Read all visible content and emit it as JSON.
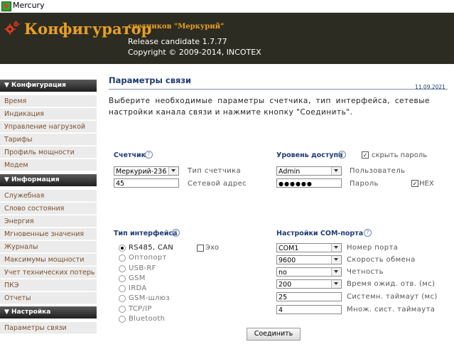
{
  "window": {
    "title": "Mercury"
  },
  "header": {
    "brand": "Конфигуратор",
    "subtitle": "счетчиков \"Меркурий\"",
    "release": "Release candidate 1.7.77",
    "copyright": "Copyright © 2009-2014, INCOTEX"
  },
  "sidebar": {
    "sections": [
      {
        "title": "▼ Конфигурация",
        "items": [
          "Время",
          "Индикация",
          "Управление нагрузкой",
          "Тарифы",
          "Профиль мощности",
          "Модем"
        ]
      },
      {
        "title": "▼ Информация",
        "items": [
          "Служебная",
          "Слово состояния",
          "Энергия",
          "Мгновенные значения",
          "Журналы",
          "Максимумы мощности",
          "Учет технических потерь",
          "ПКЭ",
          "Отчеты"
        ]
      },
      {
        "title": "▼ Настройка",
        "items": [
          "Параметры связи"
        ]
      }
    ]
  },
  "main": {
    "title": "Параметры связи",
    "date": "11.09.2021",
    "intro": "Выберите необходимые параметры счетчика, тип интерфейса, сетевые настройки канала связи и нажмите кнопку \"Соединить\".",
    "help_glyph": "?",
    "meter": {
      "label": "Счетчик",
      "type_value": "Меркурий-236",
      "type_label": "Тип счетчика",
      "address_value": "45",
      "address_label": "Сетевой адрес"
    },
    "access": {
      "label": "Уровень доступа",
      "hide_password_label": "скрыть пароль",
      "hide_password_checked": true,
      "user_value": "Admin",
      "user_label": "Пользователь",
      "password_value": "●●●●●●",
      "password_label": "Пароль",
      "hex_label": "HEX",
      "hex_checked": true
    },
    "interface": {
      "label": "Тип интерфейса",
      "options": [
        "RS485, CAN",
        "Оптопорт",
        "USB-RF",
        "GSM",
        "IRDA",
        "GSM-шлюз",
        "TCP/IP",
        "Bluetooth"
      ],
      "selected_index": 0,
      "echo_label": "Эхо",
      "echo_checked": false
    },
    "com": {
      "label": "Настройки COM-порта",
      "port_value": "COM1",
      "port_label": "Номер порта",
      "baud_value": "9600",
      "baud_label": "Скорость обмена",
      "parity_value": "no",
      "parity_label": "Четность",
      "timeout_value": "200",
      "timeout_label": "Время ожид. отв. (мс)",
      "sys_timeout_value": "25",
      "sys_timeout_label": "Системн. таймаут (мс)",
      "multiplier_value": "4",
      "multiplier_label": "Множ. сист. таймаута"
    },
    "connect_label": "Соединить"
  },
  "colors": {
    "header_bg": "#2c2c22",
    "brand": "#e8a024",
    "title_blue": "#1f3b73",
    "sidebar_text": "#7a4f2d",
    "sidebar_bg": "#ebebeb"
  }
}
